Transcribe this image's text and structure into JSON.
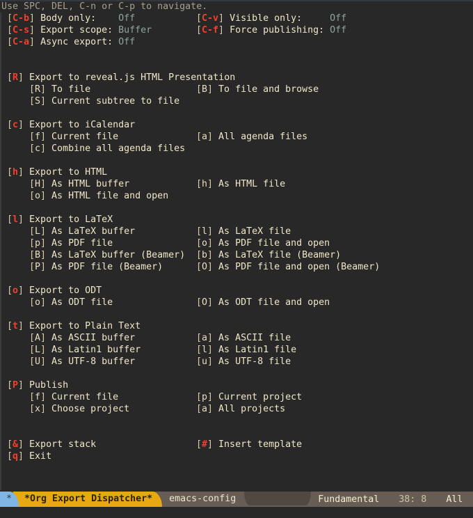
{
  "echo_area": "Use SPC, DEL, C-n or C-p to navigate.",
  "options": [
    {
      "key": "C-b",
      "label": "Body only:    ",
      "value": "Off"
    },
    {
      "key": "C-v",
      "label": "Visible only:     ",
      "value": "Off"
    },
    {
      "key": "C-s",
      "label": "Export scope: ",
      "value": "Buffer"
    },
    {
      "key": "C-f",
      "label": "Force publishing: ",
      "value": "Off"
    },
    {
      "key": "C-a",
      "label": "Async export: ",
      "value": "Off"
    }
  ],
  "sections": [
    {
      "key": "R",
      "title": "Export to reveal.js HTML Presentation",
      "rows": [
        [
          {
            "key": "R",
            "label": "To file"
          },
          {
            "key": "B",
            "label": "To file and browse"
          }
        ],
        [
          {
            "key": "S",
            "label": "Current subtree to file"
          }
        ]
      ]
    },
    {
      "key": "c",
      "title": "Export to iCalendar",
      "rows": [
        [
          {
            "key": "f",
            "label": "Current file"
          },
          {
            "key": "a",
            "label": "All agenda files"
          }
        ],
        [
          {
            "key": "c",
            "label": "Combine all agenda files"
          }
        ]
      ]
    },
    {
      "key": "h",
      "title": "Export to HTML",
      "rows": [
        [
          {
            "key": "H",
            "label": "As HTML buffer"
          },
          {
            "key": "h",
            "label": "As HTML file"
          }
        ],
        [
          {
            "key": "o",
            "label": "As HTML file and open"
          }
        ]
      ]
    },
    {
      "key": "l",
      "title": "Export to LaTeX",
      "rows": [
        [
          {
            "key": "L",
            "label": "As LaTeX buffer"
          },
          {
            "key": "l",
            "label": "As LaTeX file"
          }
        ],
        [
          {
            "key": "p",
            "label": "As PDF file"
          },
          {
            "key": "o",
            "label": "As PDF file and open"
          }
        ],
        [
          {
            "key": "B",
            "label": "As LaTeX buffer (Beamer)"
          },
          {
            "key": "b",
            "label": "As LaTeX file (Beamer)"
          }
        ],
        [
          {
            "key": "P",
            "label": "As PDF file (Beamer)"
          },
          {
            "key": "O",
            "label": "As PDF file and open (Beamer)"
          }
        ]
      ]
    },
    {
      "key": "o",
      "title": "Export to ODT",
      "rows": [
        [
          {
            "key": "o",
            "label": "As ODT file"
          },
          {
            "key": "O",
            "label": "As ODT file and open"
          }
        ]
      ]
    },
    {
      "key": "t",
      "title": "Export to Plain Text",
      "rows": [
        [
          {
            "key": "A",
            "label": "As ASCII buffer"
          },
          {
            "key": "a",
            "label": "As ASCII file"
          }
        ],
        [
          {
            "key": "L",
            "label": "As Latin1 buffer"
          },
          {
            "key": "l",
            "label": "As Latin1 file"
          }
        ],
        [
          {
            "key": "U",
            "label": "As UTF-8 buffer"
          },
          {
            "key": "u",
            "label": "As UTF-8 file"
          }
        ]
      ]
    },
    {
      "key": "P",
      "title": "Publish",
      "rows": [
        [
          {
            "key": "f",
            "label": "Current file"
          },
          {
            "key": "p",
            "label": "Current project"
          }
        ],
        [
          {
            "key": "x",
            "label": "Choose project"
          },
          {
            "key": "a",
            "label": "All projects"
          }
        ]
      ]
    }
  ],
  "footer_actions": [
    [
      {
        "key": "&",
        "label": "Export stack"
      },
      {
        "key": "#",
        "label": "Insert template"
      }
    ],
    [
      {
        "key": "q",
        "label": "Exit"
      }
    ]
  ],
  "modeline": {
    "modified": "*",
    "buffer_name": "*Org Export Dispatcher*",
    "project": "emacs-config",
    "major_mode": "Fundamental",
    "position": "38: 8",
    "scroll": "All"
  },
  "colors": {
    "background": "#282828",
    "key_accent": "#f2402c",
    "value": "#8fa59a",
    "modeline_bg": "#675d54",
    "modeline_buffer": "#e8a814",
    "modeline_star": "#7fb6e6"
  }
}
